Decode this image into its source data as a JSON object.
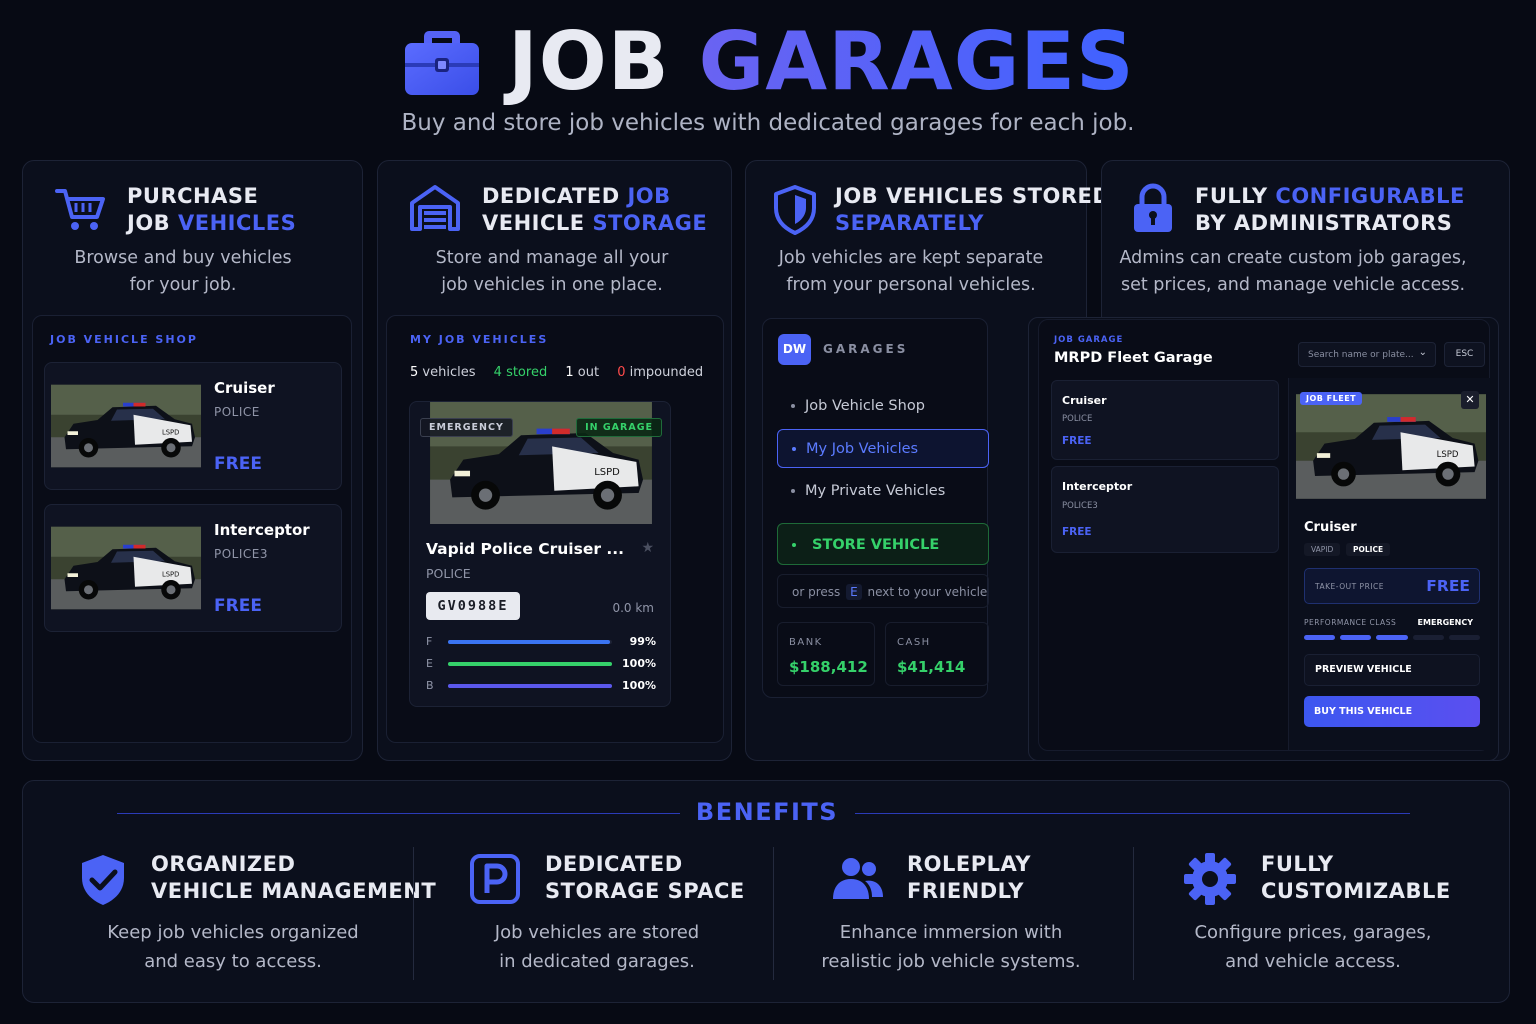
{
  "header": {
    "title_part1": "JOB",
    "title_part2": "GARAGES",
    "subtitle": "Buy and store job vehicles with dedicated garages for each job."
  },
  "features": [
    {
      "title_line1": "PURCHASE",
      "title_line2a": "JOB ",
      "title_line2b": "VEHICLES",
      "desc_line1": "Browse and buy vehicles",
      "desc_line2": "for your job."
    },
    {
      "title_line1a": "DEDICATED ",
      "title_line1b": "JOB",
      "title_line2a": "VEHICLE ",
      "title_line2b": "STORAGE",
      "desc_line1": "Store and manage all your",
      "desc_line2": "job vehicles in one place."
    },
    {
      "title_line1": "JOB VEHICLES STORED",
      "title_line2": "SEPARATELY",
      "desc_line1": "Job vehicles are kept separate",
      "desc_line2": "from your personal vehicles."
    },
    {
      "title_line1a": "FULLY ",
      "title_line1b": "CONFIGURABLE",
      "title_line2": "BY ADMINISTRATORS",
      "desc_line1": "Admins can create custom job garages,",
      "desc_line2": "set prices, and manage vehicle access."
    }
  ],
  "shop": {
    "heading": "JOB VEHICLE SHOP",
    "items": [
      {
        "name": "Cruiser",
        "class": "POLICE",
        "price": "FREE"
      },
      {
        "name": "Interceptor",
        "class": "POLICE3",
        "price": "FREE"
      }
    ]
  },
  "my_vehicles": {
    "heading": "MY JOB VEHICLES",
    "stats": {
      "vehicles_count": "5",
      "vehicles_label": "vehicles",
      "stored_count": "4",
      "stored_label": "stored",
      "out_count": "1",
      "out_label": "out",
      "impounded_count": "0",
      "impounded_label": "impounded"
    },
    "card": {
      "tag_left": "EMERGENCY",
      "tag_right": "IN GARAGE",
      "name": "Vapid Police Cruiser ...",
      "class": "POLICE",
      "plate": "GV0988E",
      "distance": "0.0 km",
      "bars": [
        {
          "label": "F",
          "value": "99%",
          "fraction": 0.99,
          "color": "#3a74f2"
        },
        {
          "label": "E",
          "value": "100%",
          "fraction": 1.0,
          "color": "#35d16a"
        },
        {
          "label": "B",
          "value": "100%",
          "fraction": 1.0,
          "color": "#5b58ec"
        }
      ]
    }
  },
  "garages_menu": {
    "logo": "DW",
    "heading": "GARAGES",
    "items": [
      "Job Vehicle Shop",
      "My Job Vehicles",
      "My Private Vehicles"
    ],
    "store_button": "STORE VEHICLE",
    "hint_prefix": "or press",
    "hint_key": "E",
    "hint_suffix": "next to your vehicle",
    "bank_label": "BANK",
    "bank_value": "$188,412",
    "cash_label": "CASH",
    "cash_value": "$41,414"
  },
  "fleet": {
    "small_heading": "JOB GARAGE",
    "title": "MRPD Fleet Garage",
    "search_placeholder": "Search name or plate...",
    "esc": "ESC",
    "list": [
      {
        "name": "Cruiser",
        "class": "POLICE",
        "price": "FREE"
      },
      {
        "name": "Interceptor",
        "class": "POLICE3",
        "price": "FREE"
      }
    ],
    "detail": {
      "badge": "JOB FLEET",
      "name": "Cruiser",
      "tag1": "VAPID",
      "tag2": "POLICE",
      "price_label": "TAKE-OUT PRICE",
      "price_value": "FREE",
      "perf_label": "PERFORMANCE CLASS",
      "perf_value": "EMERGENCY",
      "perf_level": 3,
      "perf_max": 5,
      "preview_button": "PREVIEW VEHICLE",
      "buy_button": "BUY THIS VEHICLE"
    }
  },
  "benefits": {
    "heading": "BENEFITS",
    "items": [
      {
        "title_line1": "ORGANIZED",
        "title_line2": "VEHICLE MANAGEMENT",
        "desc_line1": "Keep job vehicles organized",
        "desc_line2": "and easy to access."
      },
      {
        "title_line1": "DEDICATED",
        "title_line2": "STORAGE SPACE",
        "desc_line1": "Job vehicles are stored",
        "desc_line2": "in dedicated garages."
      },
      {
        "title_line1": "ROLEPLAY",
        "title_line2": "FRIENDLY",
        "desc_line1": "Enhance immersion with",
        "desc_line2": "realistic job vehicle systems."
      },
      {
        "title_line1": "FULLY",
        "title_line2": "CUSTOMIZABLE",
        "desc_line1": "Configure prices, garages,",
        "desc_line2": "and vehicle access."
      }
    ]
  },
  "colors": {
    "accent": "#4b63f5",
    "green": "#35d16a",
    "red": "#ff4b4b",
    "background": "#070a14"
  }
}
